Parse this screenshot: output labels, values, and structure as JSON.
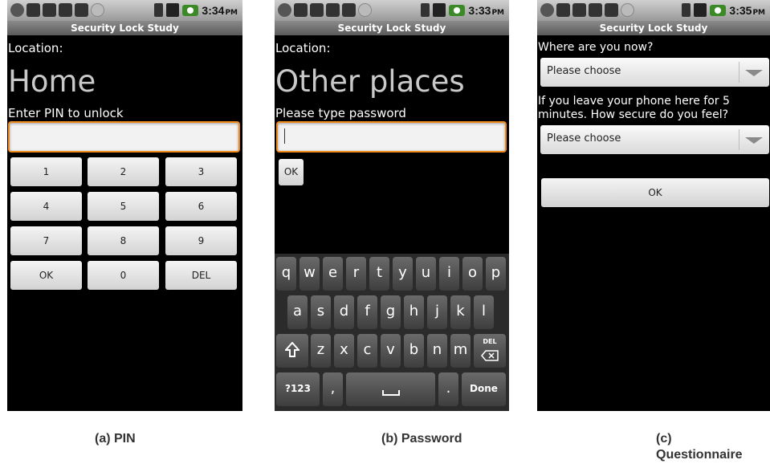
{
  "screens": [
    {
      "status_time": "3:34",
      "status_ampm": "PM",
      "title": "Security Lock Study",
      "location_label": "Location:",
      "location_value": "Home",
      "prompt": "Enter PIN to unlock",
      "keypad": [
        "1",
        "2",
        "3",
        "4",
        "5",
        "6",
        "7",
        "8",
        "9",
        "OK",
        "0",
        "DEL"
      ],
      "caption": "(a) PIN"
    },
    {
      "status_time": "3:33",
      "status_ampm": "PM",
      "title": "Security Lock Study",
      "location_label": "Location:",
      "location_value": "Other places",
      "prompt": "Please type password",
      "ok_label": "OK",
      "keyboard": {
        "row1": [
          "q",
          "w",
          "e",
          "r",
          "t",
          "y",
          "u",
          "i",
          "o",
          "p"
        ],
        "row2": [
          "a",
          "s",
          "d",
          "f",
          "g",
          "h",
          "j",
          "k",
          "l"
        ],
        "row3": [
          "z",
          "x",
          "c",
          "v",
          "b",
          "n",
          "m"
        ],
        "shift_icon": "shift-icon",
        "del_label": "DEL",
        "sym_label": "?123",
        "comma": ",",
        "period": ".",
        "done_label": "Done"
      },
      "caption": "(b) Password"
    },
    {
      "status_time": "3:35",
      "status_ampm": "PM",
      "title": "Security Lock Study",
      "q1": "Where are you now?",
      "q1_value": "Please choose",
      "q2_line1": "If you leave your phone here for 5",
      "q2_line2": "minutes. How secure do you feel?",
      "q2_value": "Please choose",
      "ok_label": "OK",
      "caption_line1": "(c)",
      "caption_line2": "Questionnaire"
    }
  ],
  "colors": {
    "focus_border": "#f08a1a",
    "battery": "#3c8a27",
    "screen_bg": "#000000"
  }
}
